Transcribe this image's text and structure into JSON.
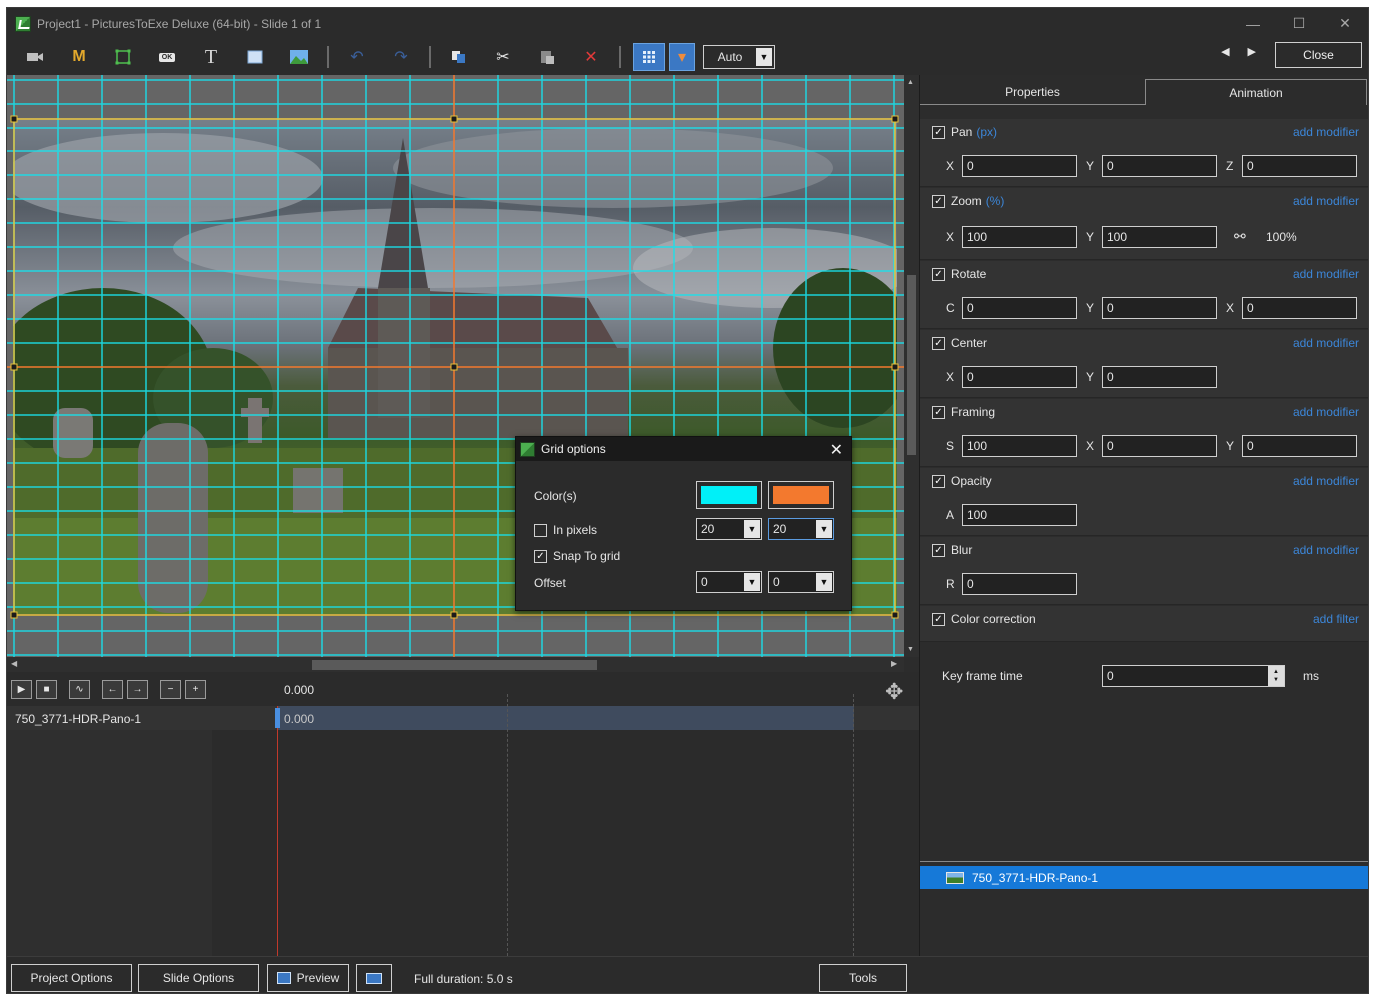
{
  "window": {
    "title": "Project1 - PicturesToExe Deluxe (64-bit) - Slide 1 of 1",
    "controls": {
      "minimize": "—",
      "maximize": "☐",
      "close": "✕"
    }
  },
  "toolbar": {
    "m_label": "M",
    "t_label": "T",
    "ok_label": "OK",
    "zoom_value": "Auto",
    "close_label": "Close",
    "prev": "◀",
    "next": "▶"
  },
  "grid_dialog": {
    "title": "Grid options",
    "colors_label": "Color(s)",
    "color1": "#00f0f8",
    "color2": "#f3792e",
    "in_pixels_label": "In pixels",
    "in_pixels_checked": false,
    "snap_label": "Snap To grid",
    "snap_checked": true,
    "offset_label": "Offset",
    "grid_x": "20",
    "grid_y": "20",
    "offset_x": "0",
    "offset_y": "0"
  },
  "timeline": {
    "ruler_time": "0.000",
    "clip_time": "0.000",
    "track_name": "750_3771-HDR-Pano-1"
  },
  "right_panel": {
    "tabs": [
      "Properties",
      "Animation"
    ],
    "sections": {
      "pan": {
        "label": "Pan",
        "unit": "(px)",
        "add": "add modifier",
        "l1": "X",
        "v1": "0",
        "l2": "Y",
        "v2": "0",
        "l3": "Z",
        "v3": "0"
      },
      "zoom": {
        "label": "Zoom",
        "unit": "(%)",
        "add": "add modifier",
        "l1": "X",
        "v1": "100",
        "l2": "Y",
        "v2": "100",
        "link_value": "100%"
      },
      "rotate": {
        "label": "Rotate",
        "add": "add modifier",
        "l1": "C",
        "v1": "0",
        "l2": "Y",
        "v2": "0",
        "l3": "X",
        "v3": "0"
      },
      "center": {
        "label": "Center",
        "add": "add modifier",
        "l1": "X",
        "v1": "0",
        "l2": "Y",
        "v2": "0"
      },
      "framing": {
        "label": "Framing",
        "add": "add modifier",
        "l1": "S",
        "v1": "100",
        "l2": "X",
        "v2": "0",
        "l3": "Y",
        "v3": "0"
      },
      "opacity": {
        "label": "Opacity",
        "add": "add modifier",
        "l1": "A",
        "v1": "100"
      },
      "blur": {
        "label": "Blur",
        "add": "add modifier",
        "l1": "R",
        "v1": "0"
      },
      "color_correction": {
        "label": "Color correction",
        "add": "add filter"
      }
    },
    "key_frame_label": "Key frame time",
    "key_frame_value": "0",
    "key_frame_unit": "ms",
    "layer_name": "750_3771-HDR-Pano-1"
  },
  "bottom": {
    "project_options": "Project Options",
    "slide_options": "Slide Options",
    "preview": "Preview",
    "duration": "Full duration: 5.0 s",
    "tools": "Tools"
  }
}
